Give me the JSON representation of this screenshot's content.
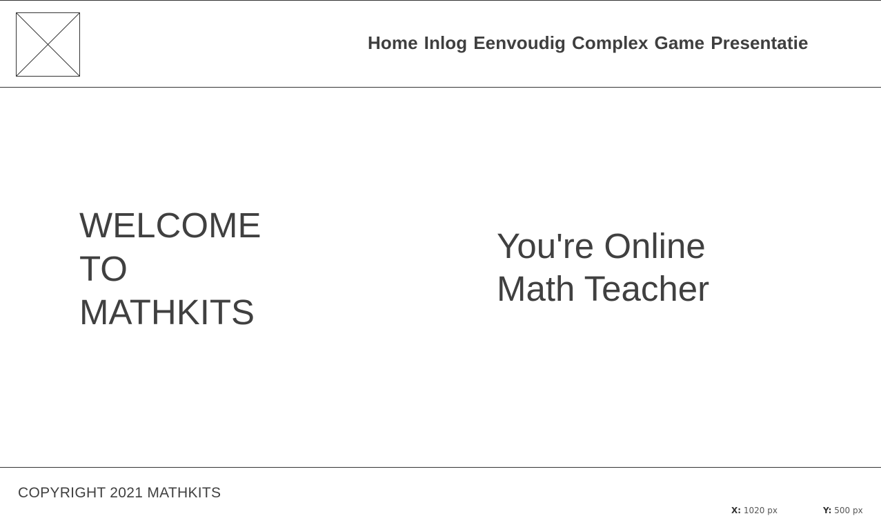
{
  "header": {
    "logo_icon": "image-placeholder-icon",
    "nav": [
      {
        "label": "Home"
      },
      {
        "label": "Inlog"
      },
      {
        "label": "Eenvoudig"
      },
      {
        "label": "Complex"
      },
      {
        "label": "Game"
      },
      {
        "label": "Presentatie"
      }
    ]
  },
  "main": {
    "welcome_lines": [
      "WELCOME",
      "TO",
      "MATHKITS"
    ],
    "tagline_lines": [
      "You're Online",
      "Math Teacher"
    ]
  },
  "footer": {
    "copyright": "COPYRIGHT 2021 MATHKITS"
  },
  "status": {
    "x_label": "X:",
    "x_value": "1020 px",
    "y_label": "Y:",
    "y_value": "500 px"
  },
  "colors": {
    "text": "#404040",
    "border": "#333333",
    "background": "#ffffff"
  }
}
